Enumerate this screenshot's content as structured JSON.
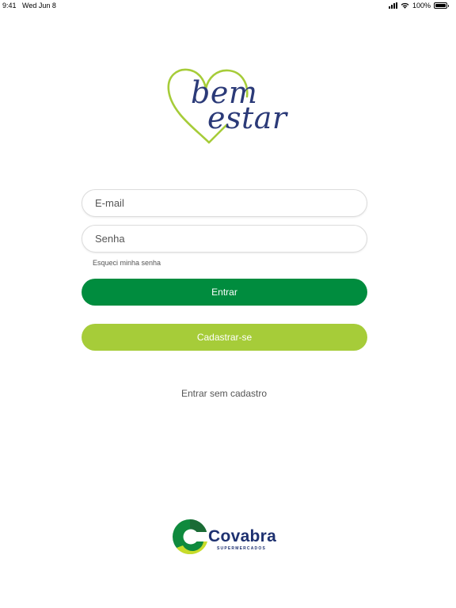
{
  "status_bar": {
    "time": "9:41",
    "date": "Wed Jun 8",
    "battery": "100%"
  },
  "logo": {
    "line1": "bem",
    "line2": "estar",
    "heart_color": "#a6cc39",
    "text_color": "#2b3a78"
  },
  "form": {
    "email_placeholder": "E-mail",
    "password_placeholder": "Senha",
    "forgot_password": "Esqueci minha senha",
    "login_button": "Entrar",
    "register_button": "Cadastrar-se",
    "guest_link": "Entrar sem cadastro"
  },
  "brand": {
    "name": "Covabra",
    "subtitle": "SUPERMERCADOS"
  },
  "colors": {
    "primary_green": "#008c3e",
    "light_green": "#a6cc39",
    "navy": "#1e3170"
  }
}
